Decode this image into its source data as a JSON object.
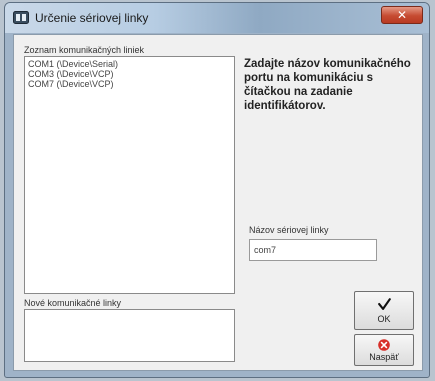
{
  "window": {
    "title": "Určenie sériovej linky",
    "close_glyph": "✕"
  },
  "list_label": "Zoznam komunikačných liniek",
  "ports": [
    "COM1 (\\Device\\Serial)",
    "COM3 (\\Device\\VCP)",
    "COM7 (\\Device\\VCP)"
  ],
  "new_lines_label": "Nové komunikačné linky",
  "instruction": "Zadajte názov komunikačného portu na komunikáciu s čítačkou na zadanie identifikátorov.",
  "field": {
    "label": "Názov sériovej linky",
    "value": "com7"
  },
  "buttons": {
    "ok_label": "OK",
    "ok_icon": "checkmark-icon",
    "back_label": "Naspäť",
    "back_icon": "cancel-icon"
  },
  "colors": {
    "close_red": "#c64b32",
    "cancel_red": "#d8302a"
  }
}
